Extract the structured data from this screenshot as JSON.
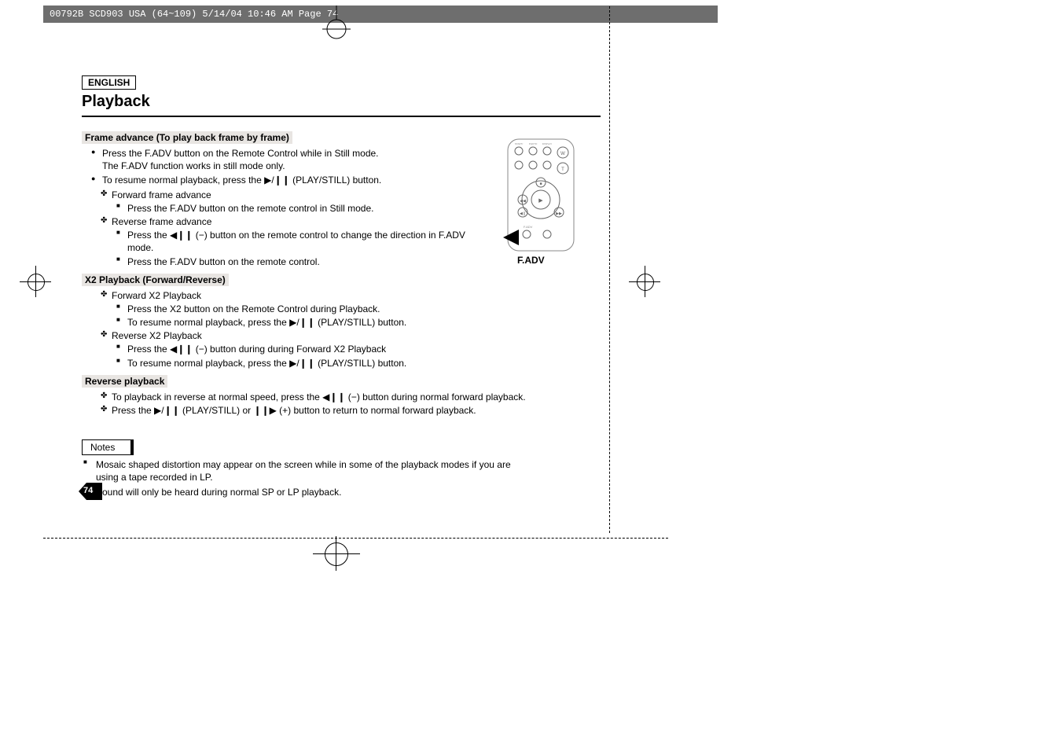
{
  "header_strip": "00792B SCD903 USA (64~109)  5/14/04 10:46 AM  Page 74",
  "lang": "ENGLISH",
  "title": "Playback",
  "section1": {
    "title": "Frame advance (To play back frame by frame)",
    "b1": "Press the F.ADV button on the Remote Control while in Still mode.",
    "b1b": "The F.ADV function works in still mode only.",
    "b2": "To resume normal playback, press the ▶/❙❙ (PLAY/STILL) button.",
    "c1": "Forward frame advance",
    "c1a": "Press the F.ADV button on the remote control in Still mode.",
    "c2": "Reverse frame advance",
    "c2a": "Press the  ◀❙❙ (−) button on the remote control to change the direction in F.ADV mode.",
    "c2b": "Press the F.ADV button on the remote control."
  },
  "section2": {
    "title": "X2 Playback (Forward/Reverse)",
    "c1": "Forward X2 Playback",
    "c1a": "Press the X2 button on the Remote Control during Playback.",
    "c1b": "To resume normal playback, press the ▶/❙❙ (PLAY/STILL) button.",
    "c2": "Reverse X2 Playback",
    "c2a": "Press the ◀❙❙ (−) button during during Forward X2 Playback",
    "c2b": "To resume normal playback, press the ▶/❙❙ (PLAY/STILL) button."
  },
  "section3": {
    "title": "Reverse playback",
    "c1": "To playback in reverse at normal speed, press the ◀❙❙ (−) button during normal forward playback.",
    "c2": "Press the ▶/❙❙ (PLAY/STILL) or ❙❙▶ (+) button to return to normal forward playback."
  },
  "notes": {
    "label": "Notes",
    "n1": "Mosaic shaped distortion may appear on the screen while in some of the playback modes if you are using a tape recorded in LP.",
    "n2": "Sound will only be heard during normal SP or LP playback."
  },
  "page_number": "74",
  "remote": {
    "fadv_label": "F.ADV"
  }
}
